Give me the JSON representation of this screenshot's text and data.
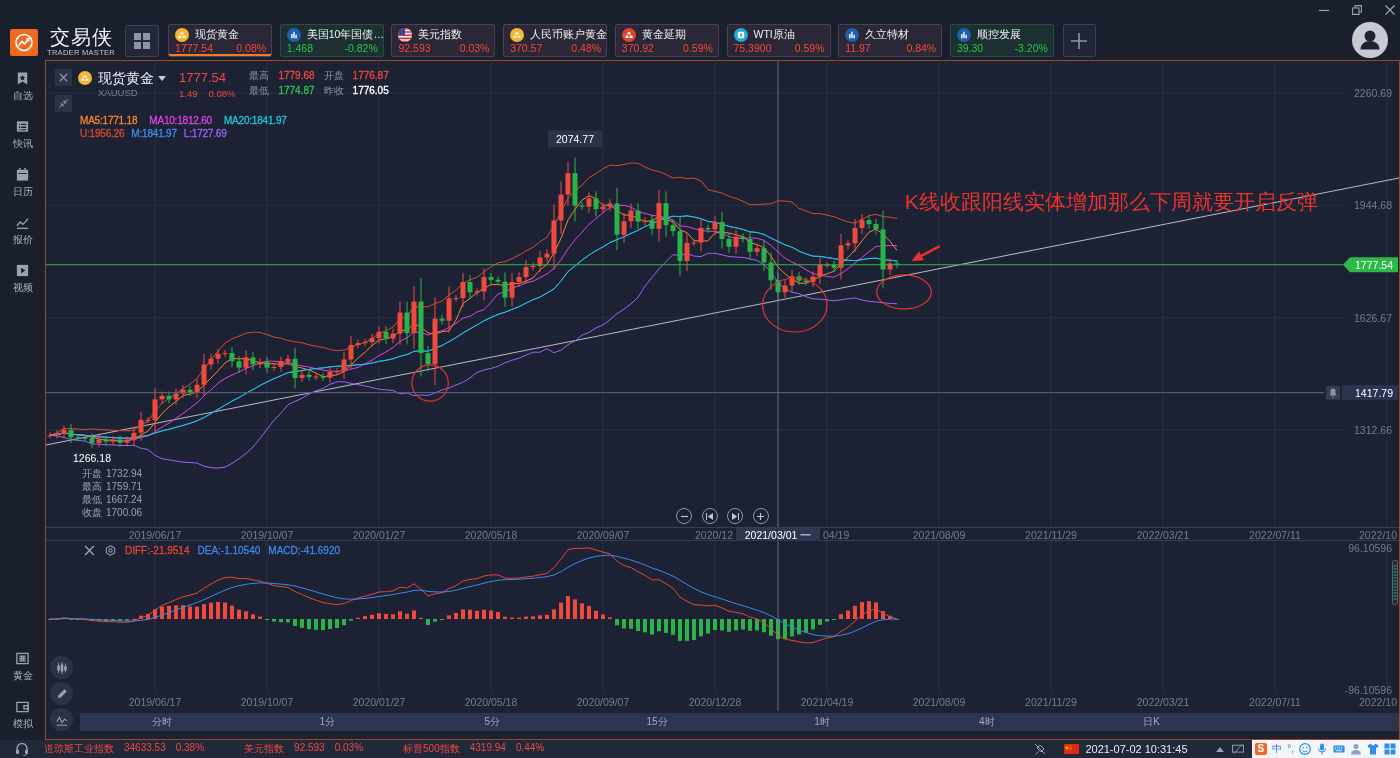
{
  "topbar": {
    "logo": {
      "name": "交易侠",
      "tagline": "TRADER MASTER"
    },
    "tabs": [
      {
        "kind": "coin",
        "name": "现货黄金",
        "price": "1777.54",
        "change": "0.08%",
        "rising": true,
        "selected": true
      },
      {
        "kind": "bars",
        "name": "美国10年国债…",
        "price": "1.468",
        "change": "-0.82%",
        "rising": false,
        "selected": false
      },
      {
        "kind": "flag",
        "name": "美元指数",
        "price": "92.593",
        "change": "0.03%",
        "rising": true,
        "selected": false
      },
      {
        "kind": "coin",
        "name": "人民币账户黄金",
        "price": "370.57",
        "change": "0.48%",
        "rising": true,
        "selected": false
      },
      {
        "kind": "ingot",
        "name": "黄金延期",
        "price": "370.92",
        "change": "0.59%",
        "rising": true,
        "selected": false
      },
      {
        "kind": "square",
        "name": "WTI原油",
        "price": "75.3900",
        "change": "0.59%",
        "rising": true,
        "selected": false
      },
      {
        "kind": "bars",
        "name": "久立特材",
        "price": "11.97",
        "change": "0.84%",
        "rising": true,
        "selected": false
      },
      {
        "kind": "bars",
        "name": "顺控发展",
        "price": "39.30",
        "change": "-3.20%",
        "rising": false,
        "selected": false
      }
    ]
  },
  "sidebar": {
    "items": [
      {
        "label": "自选"
      },
      {
        "label": "快讯"
      },
      {
        "label": "日历"
      },
      {
        "label": "报价"
      },
      {
        "label": "视频"
      }
    ],
    "bottom_items": [
      {
        "label": "黄金"
      },
      {
        "label": "模拟"
      }
    ]
  },
  "chart": {
    "quote": {
      "name": "现货黄金",
      "symbol": "XAUUSD",
      "price": "1777.54",
      "change": "1.49",
      "change_pct": "0.08%",
      "rising": true,
      "stats": [
        {
          "label": "最高",
          "value": "1779.68",
          "color": "#f0483c"
        },
        {
          "label": "开盘",
          "value": "1776.87",
          "color": "#f0483c"
        },
        {
          "label": "最低",
          "value": "1774.87",
          "color": "#2ec14b"
        },
        {
          "label": "昨收",
          "value": "1776.05",
          "color": "#ffffff"
        }
      ]
    },
    "ma_legend": [
      {
        "text": "MA5:1771.18",
        "color": "#f5862a"
      },
      {
        "text": "MA10:1812.60",
        "color": "#e03fe3"
      },
      {
        "text": "MA20:1841.97",
        "color": "#21c4d8"
      }
    ],
    "boll_legend": [
      {
        "text": "U:1956.26",
        "color": "#d8492f"
      },
      {
        "text": "M:1841.97",
        "color": "#3f8ceb"
      },
      {
        "text": "L:1727.69",
        "color": "#9a63f2"
      }
    ],
    "price_axis": [
      "2260.69",
      "1944.68",
      "1626.67",
      "1312.66"
    ],
    "high_label": "2074.77",
    "low_label": "1266.18",
    "last_price": "1777.54",
    "alert_price": "1417.79",
    "annotation": "K线收跟阳线实体增加那么下周就要开启反弹",
    "tooltip": [
      {
        "label": "开盘",
        "value": "1732.94"
      },
      {
        "label": "最高",
        "value": "1759.71"
      },
      {
        "label": "最低",
        "value": "1667.24"
      },
      {
        "label": "收盘",
        "value": "1700.06"
      }
    ],
    "date_axis": [
      "2019/06/17",
      "2019/10/07",
      "2020/01/27",
      "2020/05/18",
      "2020/09/07",
      "2020/12",
      "04/19",
      "2021/08/09",
      "2021/11/29",
      "2022/03/21",
      "2022/07/11",
      "2022/10"
    ],
    "crosshair_date": "2021/03/01 一"
  },
  "macd": {
    "legend": [
      {
        "text": "DIFF:-21.9514",
        "color": "#e0472f"
      },
      {
        "text": "DEA:-1.10540",
        "color": "#3f86e6"
      },
      {
        "text": "MACD:-41.6920",
        "color": "#3f86e6"
      }
    ],
    "value_axis": [
      "96.10596",
      "-96.10596"
    ],
    "date_axis": [
      "2019/06/17",
      "2019/10/07",
      "2020/01/27",
      "2020/05/18",
      "2020/09/07",
      "2020/12/28",
      "2021/04/19",
      "2021/08/09",
      "2021/11/29",
      "2022/03/21",
      "2022/07/11",
      "2022/10"
    ]
  },
  "periods": [
    {
      "label": "分时",
      "selected": false
    },
    {
      "label": "1分",
      "selected": false
    },
    {
      "label": "5分",
      "selected": false
    },
    {
      "label": "15分",
      "selected": false
    },
    {
      "label": "1时",
      "selected": false
    },
    {
      "label": "4时",
      "selected": false
    },
    {
      "label": "日K",
      "selected": false
    }
  ],
  "status_bar": {
    "tickers": [
      {
        "name": "道琼斯工业指数",
        "value": "34633.53",
        "change": "0.38%",
        "rising": true
      },
      {
        "name": "美元指数",
        "value": "92.593",
        "change": "0.03%",
        "rising": true
      },
      {
        "name": "标普500指数",
        "value": "4319.94",
        "change": "0.44%",
        "rising": true
      }
    ],
    "datetime": "2021-07-02 10:31:45",
    "ime": {
      "logo": "S",
      "mode": "中",
      "punctuation": "°,"
    }
  }
}
